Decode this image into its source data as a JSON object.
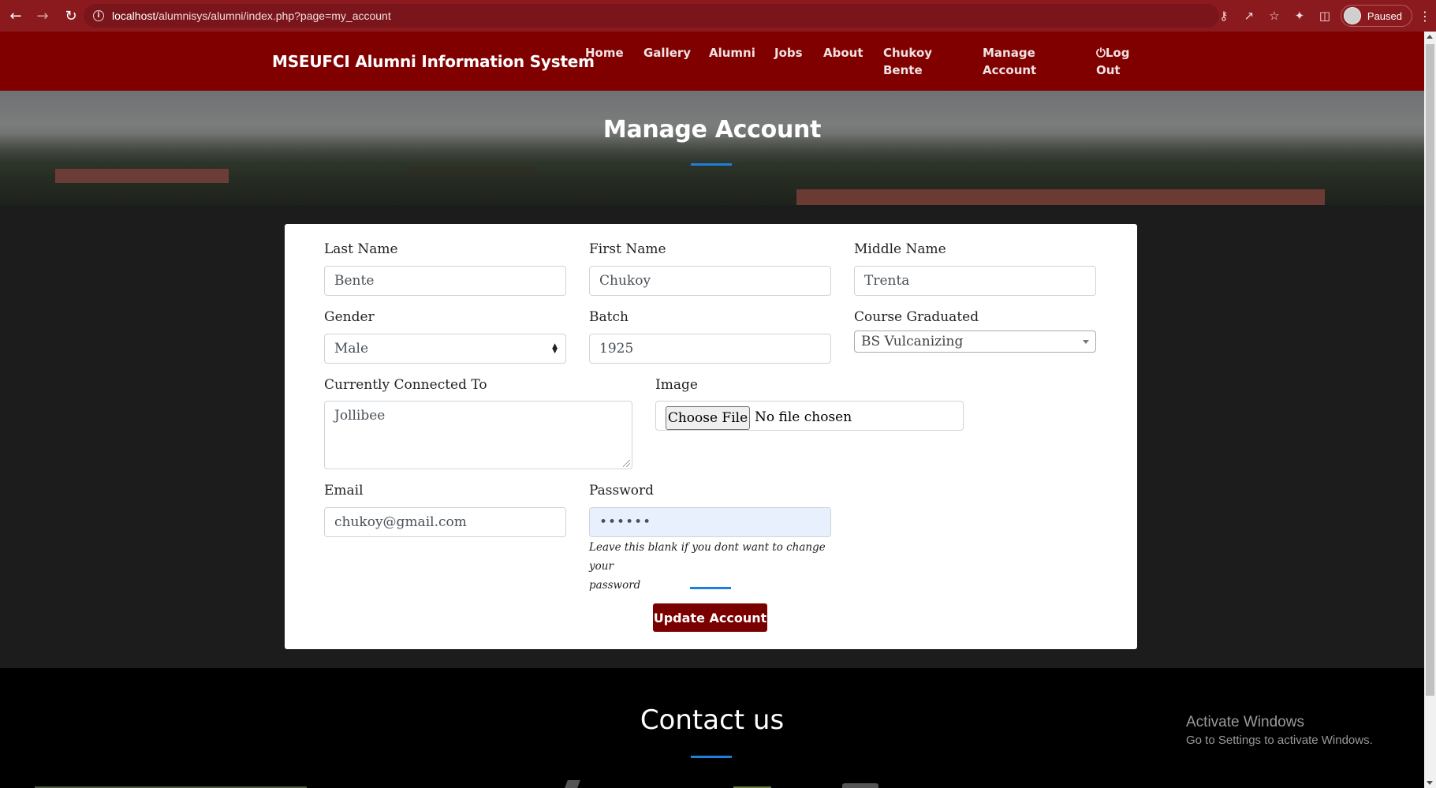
{
  "browser": {
    "url_host": "localhost",
    "url_path": "/alumnisys/alumni/index.php?page=my_account",
    "profile_status": "Paused"
  },
  "site": {
    "brand": "MSEUFCI Alumni Information System",
    "nav": {
      "home": "Home",
      "gallery": "Gallery",
      "alumni": "Alumni",
      "jobs": "Jobs",
      "about": "About",
      "user_line1": "Chukoy",
      "user_line2": "Bente",
      "manage_line1": "Manage",
      "manage_line2": "Account",
      "logout_line1": "Log",
      "logout_line2": "Out",
      "logout_icon": "power-icon"
    }
  },
  "page": {
    "title": "Manage Account"
  },
  "form": {
    "last_name": {
      "label": "Last Name",
      "value": "Bente"
    },
    "first_name": {
      "label": "First Name",
      "value": "Chukoy"
    },
    "middle_name": {
      "label": "Middle Name",
      "value": "Trenta"
    },
    "gender": {
      "label": "Gender",
      "value": "Male"
    },
    "batch": {
      "label": "Batch",
      "value": "1925"
    },
    "course": {
      "label": "Course Graduated",
      "value": "BS Vulcanizing"
    },
    "connected_to": {
      "label": "Currently Connected To",
      "value": "Jollibee"
    },
    "image": {
      "label": "Image",
      "button": "Choose File",
      "status": "No file chosen"
    },
    "email": {
      "label": "Email",
      "value": "chukoy@gmail.com"
    },
    "password": {
      "label": "Password",
      "value": "••••••",
      "hint_line1": "Leave this blank if you dont want to change your",
      "hint_line2": "password"
    },
    "submit": "Update Account"
  },
  "footer": {
    "heading": "Contact us"
  },
  "watermark": {
    "line1": "Activate Windows",
    "line2": "Go to Settings to activate Windows."
  },
  "colors": {
    "brand": "#800000",
    "accent": "#1e7fdc",
    "button": "#7a0000"
  }
}
